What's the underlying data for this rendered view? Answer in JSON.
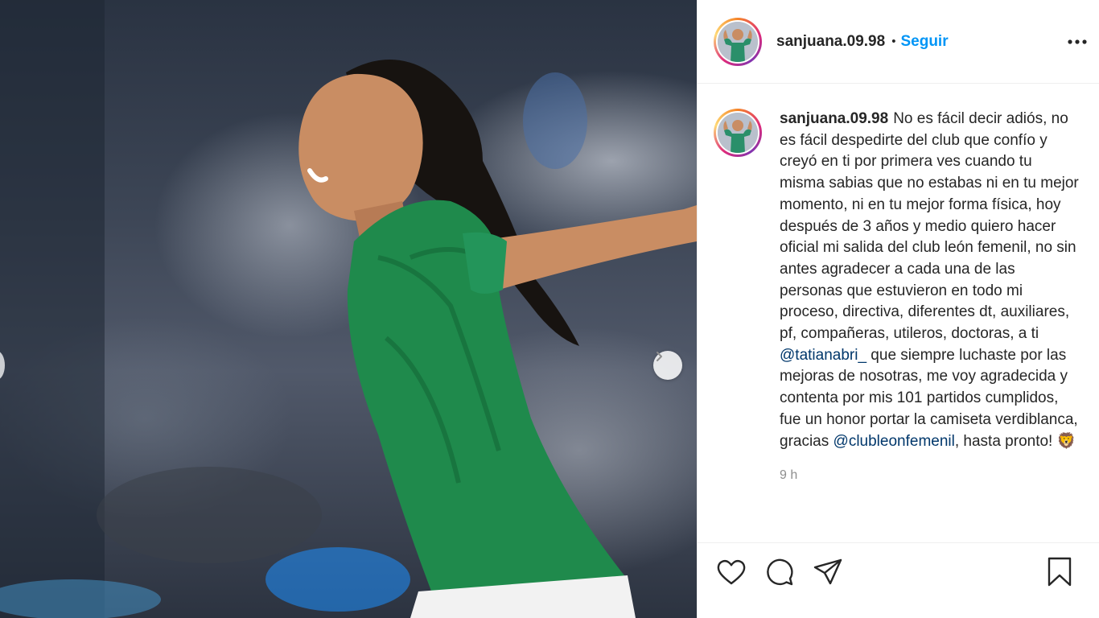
{
  "post": {
    "username": "sanjuana.09.98",
    "separator": "•",
    "follow_label": "Seguir",
    "more_icon": "more-options-icon",
    "caption": {
      "part1": "No es fácil decir adiós, no es fácil despedirte del club que confío y creyó en ti por primera ves cuando tu misma sabias que no estabas ni en tu mejor momento, ni en tu mejor forma física, hoy después de 3 años y medio quiero hacer oficial mi salida del club león femenil, no sin antes agradecer a cada una de las personas que estuvieron en todo mi proceso, directiva, diferentes dt, auxiliares, pf, compañeras, utileros, doctoras, a ti ",
      "mention1": "@tatianabri_",
      "part2": " que siempre luchaste por las mejoras de nosotras, me voy agradecida y contenta por mis 101 partidos cumplidos, fue un honor portar la camiseta verdiblanca, gracias ",
      "mention2": "@clubleonfemenil",
      "part3": ", hasta pronto! ",
      "emoji": "🦁"
    },
    "timestamp": "9 h"
  },
  "actions": {
    "like_icon": "heart-icon",
    "comment_icon": "comment-icon",
    "share_icon": "share-icon",
    "save_icon": "bookmark-icon"
  },
  "colors": {
    "link": "#0095f6",
    "mention": "#00376b",
    "jersey": "#1f8a4c",
    "muted": "#8e8e8e"
  }
}
